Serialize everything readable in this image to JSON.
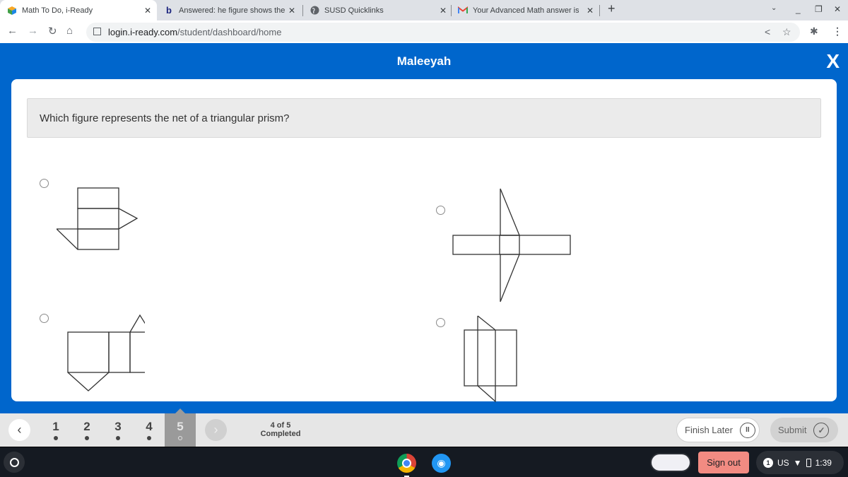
{
  "browser": {
    "tabs": [
      {
        "title": "Math To Do, i-Ready",
        "icon": "iready-cube-icon",
        "active": true
      },
      {
        "title": "Answered: he figure shows the n",
        "icon": "bartleby-b-icon",
        "active": false
      },
      {
        "title": "SUSD Quicklinks",
        "icon": "globe-icon",
        "active": false
      },
      {
        "title": "Your Advanced Math answer is r",
        "icon": "gmail-icon",
        "active": false
      }
    ],
    "new_tab_label": "+",
    "url_host": "login.i-ready.com",
    "url_path": "/student/dashboard/home"
  },
  "app": {
    "student_name": "Maleeyah",
    "close_label": "X",
    "question": "Which figure represents the net of a triangular prism?",
    "options": [
      {
        "id": "A",
        "description": "Three stacked rectangles with triangle on right of middle and triangle on left of bottom",
        "selected": false
      },
      {
        "id": "B",
        "description": "Horizontal strip of rectangles with tall triangles above and below a center square",
        "selected": false
      },
      {
        "id": "C",
        "description": "Row of three rectangles with triangle above right rectangle and triangle below left rectangle",
        "selected": false
      },
      {
        "id": "D",
        "description": "Rectangle with overlapping slanted parallelogram",
        "selected": false
      }
    ]
  },
  "footer": {
    "questions": [
      {
        "label": "1",
        "completed": true
      },
      {
        "label": "2",
        "completed": true
      },
      {
        "label": "3",
        "completed": true
      },
      {
        "label": "4",
        "completed": true
      },
      {
        "label": "5",
        "completed": false,
        "current": true
      }
    ],
    "progress_line1": "4 of 5",
    "progress_line2": "Completed",
    "finish_later_label": "Finish Later",
    "submit_label": "Submit"
  },
  "shelf": {
    "sign_out_label": "Sign out",
    "notification_count": "1",
    "input_method": "US",
    "time": "1:39"
  },
  "colors": {
    "brand_blue": "#0066cc",
    "sign_out": "#f28b82"
  }
}
